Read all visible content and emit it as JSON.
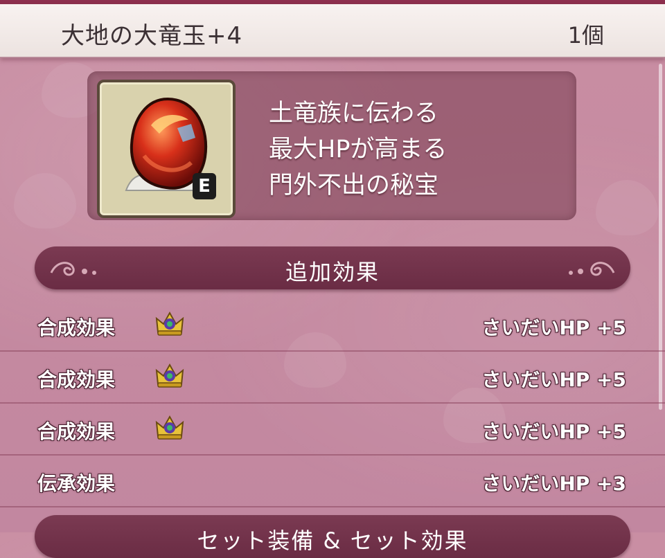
{
  "item": {
    "name": "大地の大竜玉+4",
    "quantity": "1個",
    "equipped_badge": "E",
    "icon": "jewel-icon",
    "description_lines": [
      "土竜族に伝わる",
      "最大HPが高まる",
      "門外不出の秘宝"
    ]
  },
  "sections": {
    "additional_effects_title": "追加効果",
    "set_effects_title_partial": "セット装備 & セット効果"
  },
  "effects": [
    {
      "label": "合成効果",
      "icon": "crown-icon",
      "value": "さいだいHP +5"
    },
    {
      "label": "合成効果",
      "icon": "crown-icon",
      "value": "さいだいHP +5"
    },
    {
      "label": "合成効果",
      "icon": "crown-icon",
      "value": "さいだいHP +5"
    },
    {
      "label": "伝承効果",
      "icon": "",
      "value": "さいだいHP +3"
    }
  ],
  "colors": {
    "background": "#c58aa0",
    "header_band": "#6a2c44",
    "title_bar": "#f2ebe8"
  }
}
